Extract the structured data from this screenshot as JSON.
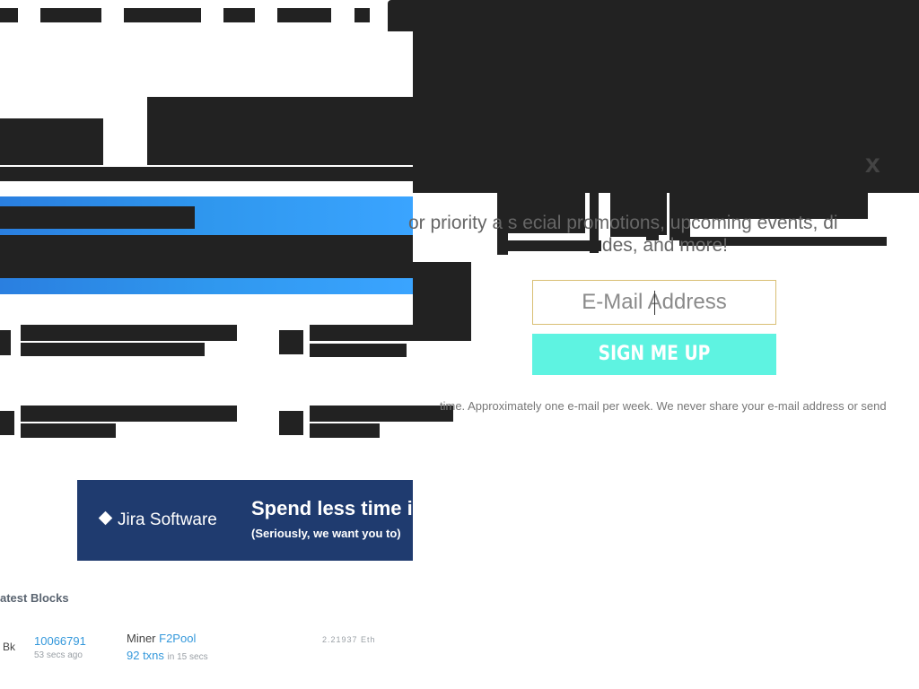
{
  "newsletter": {
    "promo_line1": "or priority a            s    ecial promotions, upcoming events, di",
    "promo_line2": "des, and more!",
    "partial_heading_char": "x",
    "email_placeholder": "E-Mail Address",
    "signup_label": "SIGN ME UP",
    "disclaimer": "time.   Approximately one e-mail per week.   We never share your e-mail address or send"
  },
  "ad": {
    "brand": "Jira Software",
    "headline": "Spend less time in",
    "subline": "(Seriously, we want you to)"
  },
  "latest_blocks": {
    "title": "atest Blocks",
    "rows": [
      {
        "badge": "Bk",
        "number": "10066791",
        "age": "53 secs ago",
        "miner_prefix": "Miner",
        "miner": "F2Pool",
        "txns": "92 txns",
        "txns_suffix": "in 15 secs",
        "reward": "2.21937 Eth"
      }
    ]
  },
  "colors": {
    "redaction": "#222222",
    "accent_link": "#3498db",
    "signup_button": "#5ef3e1",
    "ad_background": "#1f3b6f",
    "input_border": "#d9bf74"
  }
}
